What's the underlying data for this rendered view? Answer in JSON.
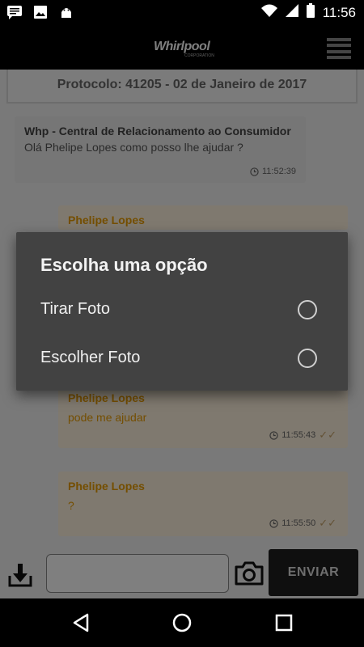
{
  "status_bar": {
    "time": "11:56",
    "left_icons": [
      "message-icon",
      "image-icon",
      "android-icon"
    ],
    "right_icons": [
      "wifi-icon",
      "signal-icon",
      "battery-icon"
    ]
  },
  "header": {
    "logo_text": "Whirlpool",
    "logo_tagline": "CORPORATION",
    "menu_icon": "hamburger-menu-icon"
  },
  "protocol": "Protocolo: 41205 - 02 de Janeiro de 2017",
  "messages": [
    {
      "type": "agent",
      "sender": "Whp - Central de Relacionamento ao Consumidor",
      "text": "Olá Phelipe Lopes como posso lhe ajudar ?",
      "time": "11:52:39"
    },
    {
      "type": "user",
      "sender": "Phelipe Lopes",
      "text": "",
      "time": ""
    },
    {
      "type": "user",
      "sender": "Phelipe Lopes",
      "text": "pode me ajudar",
      "time": "11:55:43",
      "read_icon": "double-check-icon"
    },
    {
      "type": "user",
      "sender": "Phelipe Lopes",
      "text": "?",
      "time": "11:55:50",
      "read_icon": "double-check-icon"
    }
  ],
  "composer": {
    "attach_icon": "download-icon",
    "input_placeholder": "",
    "camera_icon": "camera-icon",
    "send_label": "ENVIAR"
  },
  "dialog": {
    "title": "Escolha uma opção",
    "options": [
      {
        "label": "Tirar Foto",
        "selected": false
      },
      {
        "label": "Escolher Foto",
        "selected": false
      }
    ]
  },
  "nav_bar": {
    "items": [
      "back-icon",
      "home-icon",
      "recents-icon"
    ]
  },
  "colors": {
    "accent": "#e99c00",
    "agent_bubble": "#ececec",
    "user_bubble": "#fff3df",
    "dialog_bg": "#424242"
  }
}
